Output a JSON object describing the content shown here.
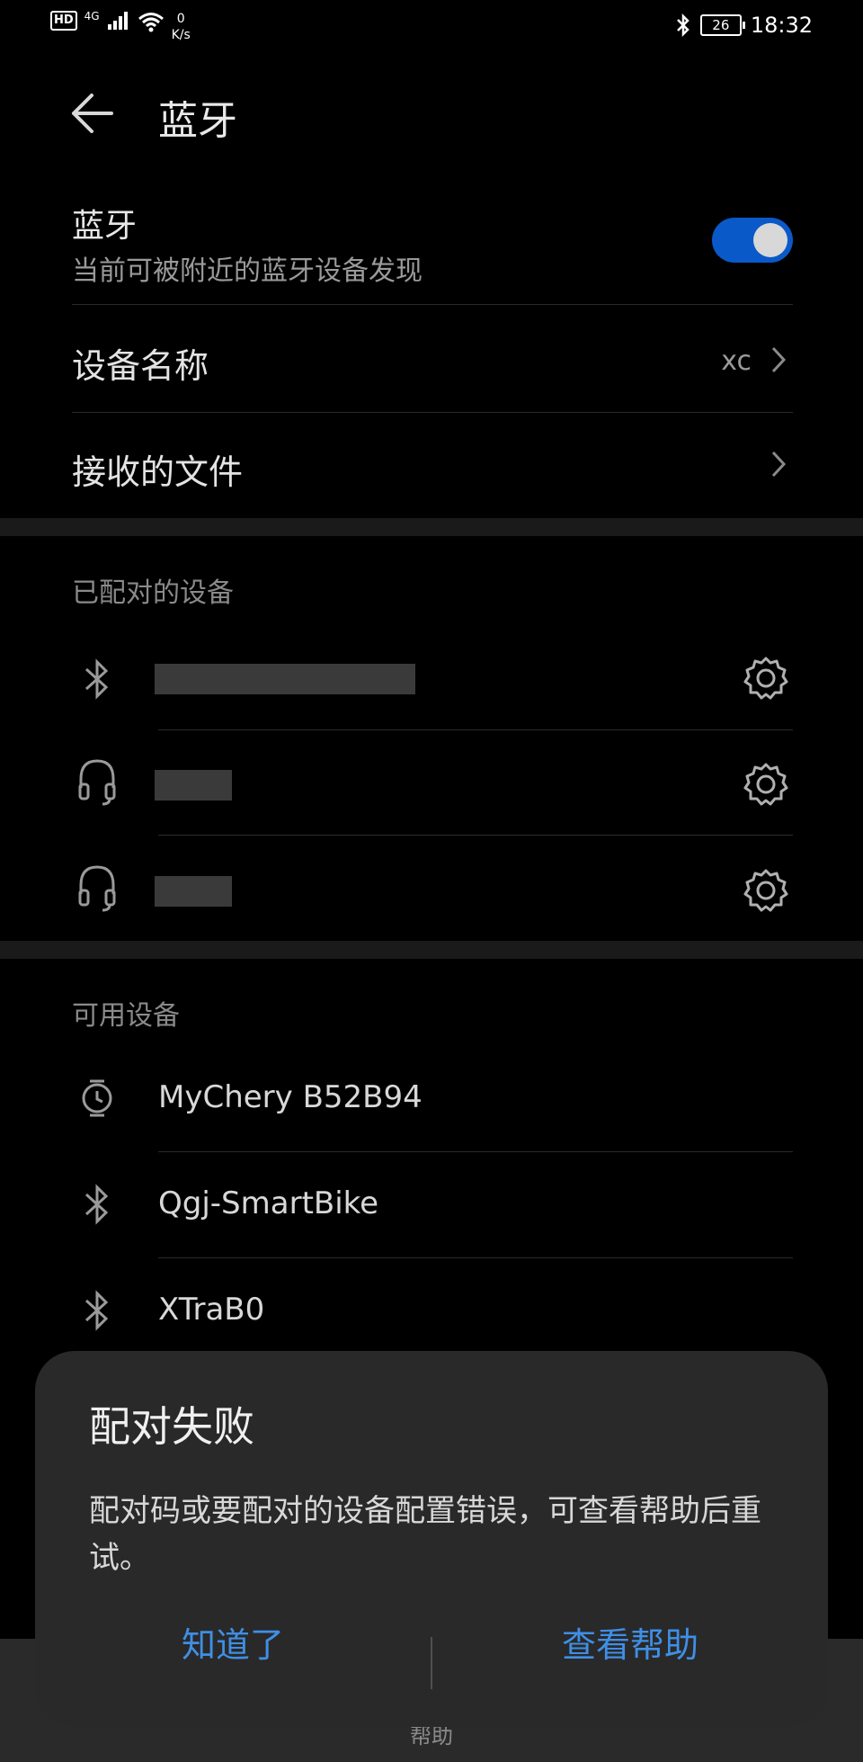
{
  "status_bar": {
    "left_badge": "HD",
    "signal_type": "4G",
    "net_speed_value": "0",
    "net_speed_unit": "K/s",
    "battery": "26",
    "time": "18:32"
  },
  "header": {
    "title": "蓝牙"
  },
  "bluetooth": {
    "title": "蓝牙",
    "subtitle": "当前可被附近的蓝牙设备发现",
    "enabled": true,
    "toggle_color": "#0a59c8"
  },
  "settings": [
    {
      "label": "设备名称",
      "value": "xc"
    },
    {
      "label": "接收的文件",
      "value": ""
    }
  ],
  "paired": {
    "title": "已配对的设备",
    "devices": [
      {
        "icon": "bluetooth-icon"
      },
      {
        "icon": "headset-icon"
      },
      {
        "icon": "headset-icon"
      }
    ]
  },
  "available": {
    "title": "可用设备",
    "devices": [
      {
        "icon": "watch-icon",
        "name": "MyChery  B52B94"
      },
      {
        "icon": "bluetooth-icon",
        "name": "Qgj-SmartBike"
      },
      {
        "icon": "bluetooth-icon",
        "name": "XTraB0"
      }
    ]
  },
  "bottom": {
    "help_label": "帮助"
  },
  "dialog": {
    "title": "配对失败",
    "message": "配对码或要配对的设备配置错误，可查看帮助后重试。",
    "ok_label": "知道了",
    "help_label": "查看帮助",
    "button_color": "#3f8fe6"
  }
}
